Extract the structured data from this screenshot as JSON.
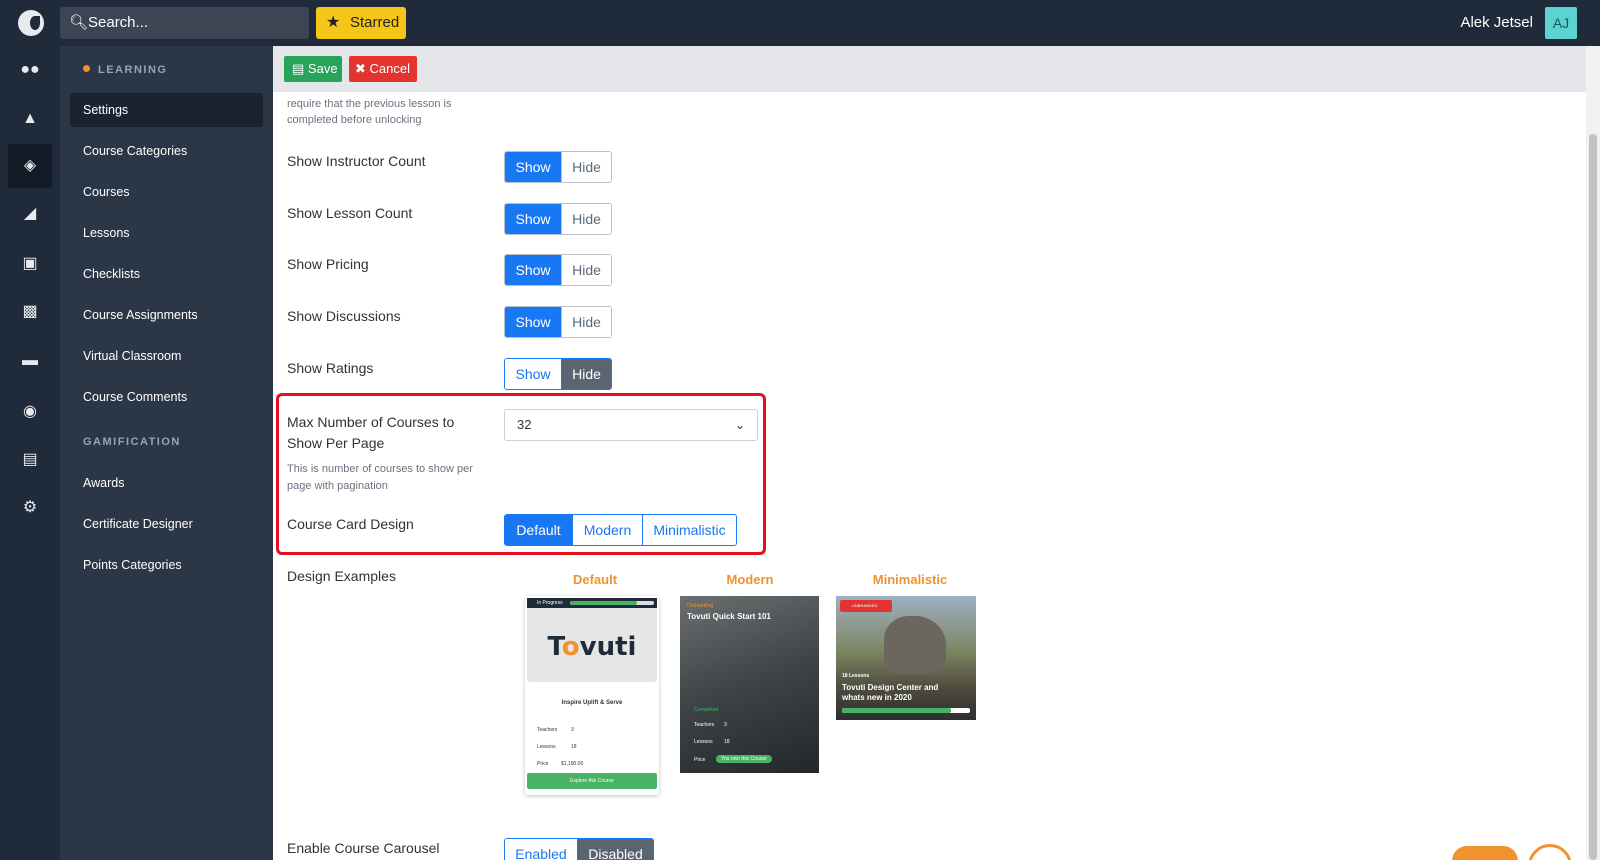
{
  "topbar": {
    "search_placeholder": "Search...",
    "starred_label": "Starred",
    "user_name": "Alek Jetsel",
    "avatar_initials": "AJ"
  },
  "rail": {
    "icons": [
      "users-icon",
      "shapes-icon",
      "graduation-cap-icon",
      "megaphone-icon",
      "money-icon",
      "chart-icon",
      "chat-icon",
      "palette-icon",
      "window-icon",
      "gear-icon"
    ],
    "active": "graduation-cap-icon"
  },
  "sidebar": {
    "learning_label": "LEARNING",
    "learning_items": [
      "Settings",
      "Course Categories",
      "Courses",
      "Lessons",
      "Checklists",
      "Course Assignments",
      "Virtual Classroom",
      "Course Comments"
    ],
    "gamification_label": "GAMIFICATION",
    "gamification_items": [
      "Awards",
      "Certificate Designer",
      "Points Categories"
    ],
    "active_item": "Settings"
  },
  "toolbar": {
    "save_label": "Save",
    "cancel_label": "Cancel"
  },
  "settings": {
    "lesson_lock_help": "When enabled all course lessons will require that the previous lesson is completed before unlocking",
    "rows": [
      {
        "label": "Show Instructor Count",
        "options": [
          "Show",
          "Hide"
        ],
        "selected": "Show"
      },
      {
        "label": "Show Lesson Count",
        "options": [
          "Show",
          "Hide"
        ],
        "selected": "Show"
      },
      {
        "label": "Show Pricing",
        "options": [
          "Show",
          "Hide"
        ],
        "selected": "Show"
      },
      {
        "label": "Show Discussions",
        "options": [
          "Show",
          "Hide"
        ],
        "selected": "Show"
      },
      {
        "label": "Show Ratings",
        "options": [
          "Show",
          "Hide"
        ],
        "selected": "Hide"
      }
    ],
    "max_courses": {
      "label": "Max Number of Courses to Show Per Page",
      "value": "32",
      "help": "This is number of courses to show per page with pagination"
    },
    "card_design": {
      "label": "Course Card Design",
      "options": [
        "Default",
        "Modern",
        "Minimalistic"
      ],
      "selected": "Default"
    },
    "design_examples": {
      "label": "Design Examples",
      "titles": [
        "Default",
        "Modern",
        "Minimalistic"
      ]
    },
    "carousel": {
      "label": "Enable Course Carousel",
      "options": [
        "Enabled",
        "Disabled"
      ],
      "selected": "Disabled"
    }
  },
  "cards": {
    "default": {
      "status": "In Progress",
      "brand_pre": "T",
      "brand_o": "o",
      "brand_post": "vuti",
      "tagline": "Inspire Uplift & Serve",
      "teachers_label": "Teachers",
      "teachers_count": "3",
      "lessons_label": "Lessons",
      "lessons_count": "18",
      "price_label": "Price",
      "price_value": "$1,190.00",
      "cta": "Explore this Course"
    },
    "modern": {
      "category": "Onboarding",
      "title": "Tovuti Quick Start 101",
      "status": "Completed",
      "teachers_label": "Teachers",
      "teachers_count": "3",
      "lessons_label": "Lessons",
      "lessons_count": "18",
      "price_label": "Price",
      "price_value": "You own this Course"
    },
    "minimalistic": {
      "badge": "UNBRANDED",
      "lessons": "18 Lessons",
      "title": "Tovuti Design Center and whats new in 2020",
      "progress": 0.85
    }
  },
  "colors": {
    "topbar": "#1f2a3a",
    "accent_blue": "#1877f2",
    "accent_orange": "#f0922e",
    "save_green": "#28a35a",
    "cancel_red": "#e3342f",
    "highlight_red": "#e3101e"
  }
}
